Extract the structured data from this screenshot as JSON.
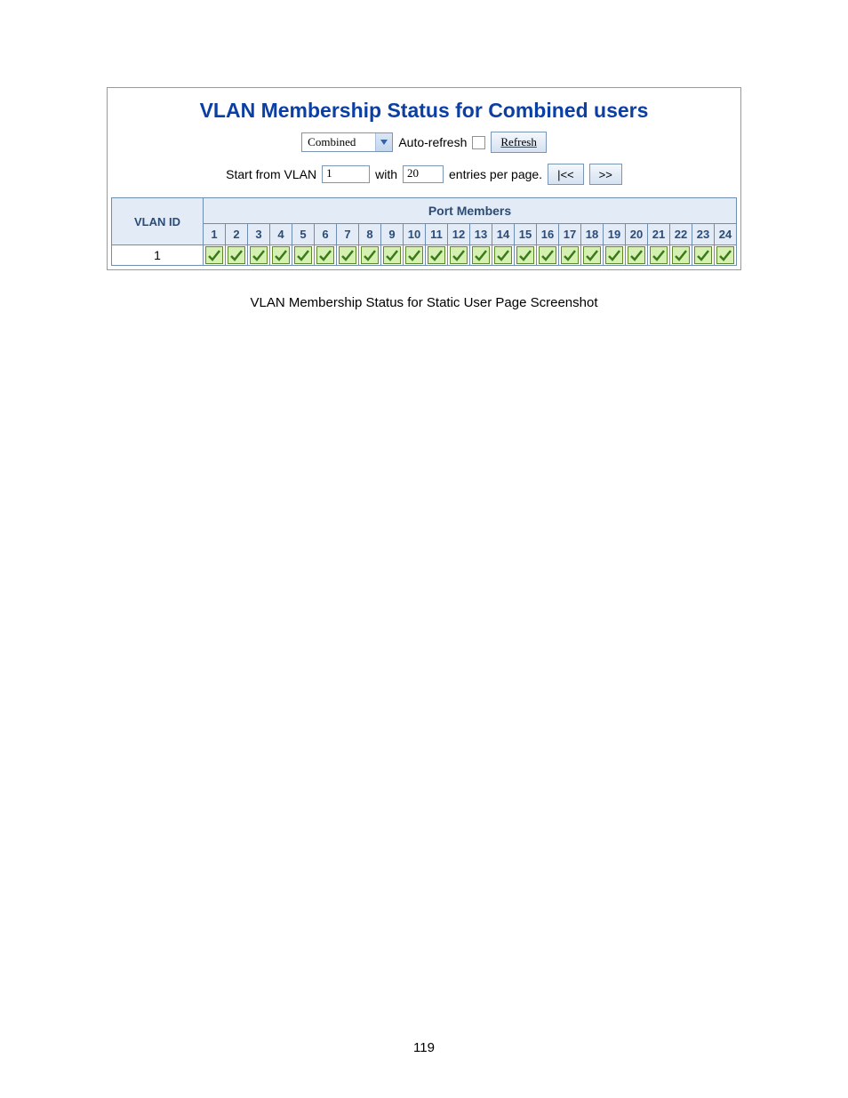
{
  "title": "VLAN Membership Status for Combined users",
  "controls": {
    "user_select_value": "Combined",
    "auto_refresh_label": "Auto-refresh",
    "refresh_button": "Refresh",
    "start_label_prefix": "Start from VLAN",
    "start_value": "1",
    "with_label": "with",
    "entries_value": "20",
    "entries_label_suffix": "entries per page.",
    "first_button": "|<<",
    "next_button": ">>"
  },
  "table": {
    "vlan_id_header": "VLAN ID",
    "port_members_header": "Port Members",
    "port_numbers": [
      "1",
      "2",
      "3",
      "4",
      "5",
      "6",
      "7",
      "8",
      "9",
      "10",
      "11",
      "12",
      "13",
      "14",
      "15",
      "16",
      "17",
      "18",
      "19",
      "20",
      "21",
      "22",
      "23",
      "24"
    ],
    "rows": [
      {
        "vlan_id": "1",
        "members": [
          true,
          true,
          true,
          true,
          true,
          true,
          true,
          true,
          true,
          true,
          true,
          true,
          true,
          true,
          true,
          true,
          true,
          true,
          true,
          true,
          true,
          true,
          true,
          true
        ]
      }
    ]
  },
  "caption": "VLAN Membership Status for Static User Page Screenshot",
  "page_number": "119"
}
